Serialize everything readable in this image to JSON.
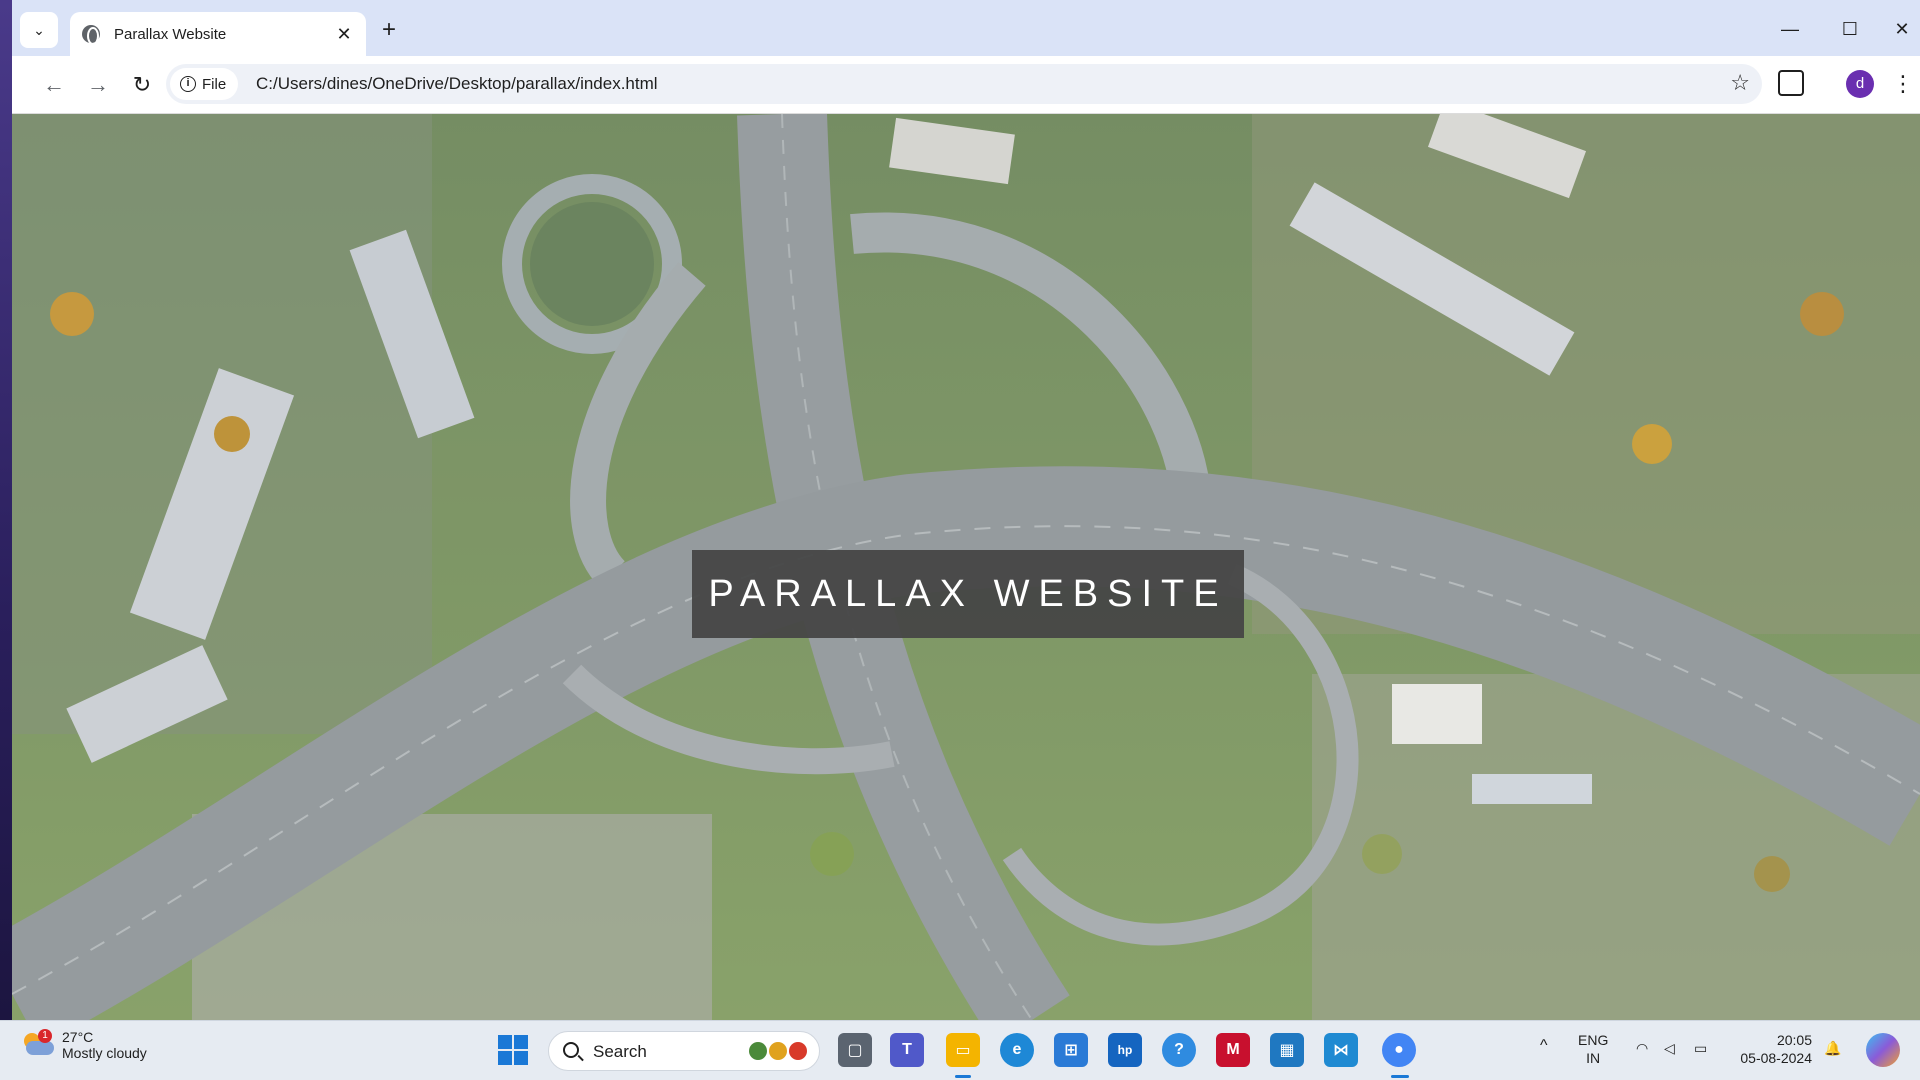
{
  "browser": {
    "tab_title": "Parallax Website",
    "tab_close": "✕",
    "new_tab": "+",
    "chip_label": "File",
    "url": "C:/Users/dines/OneDrive/Desktop/parallax/index.html",
    "profile_initial": "d",
    "window_controls": {
      "minimize": "—",
      "maximize": "☐",
      "close": "✕"
    },
    "nav": {
      "back": "←",
      "forward": "→",
      "reload": "↻"
    },
    "icons": [
      "tab-search-icon",
      "globe-icon",
      "info-icon",
      "star-icon",
      "extensions-icon",
      "kebab-menu-icon"
    ]
  },
  "page": {
    "hero_title": "PARALLAX WEBSITE"
  },
  "taskbar": {
    "weather": {
      "temp": "27°C",
      "desc": "Mostly cloudy",
      "badge": "1"
    },
    "search_label": "Search",
    "lang": {
      "line1": "ENG",
      "line2": "IN"
    },
    "time": "20:05",
    "date": "05-08-2024",
    "chevron": "^",
    "tray_icons": [
      "wifi-icon",
      "volume-icon",
      "battery-icon",
      "bell-icon"
    ],
    "apps": [
      "file-explorer-icon",
      "teams-icon",
      "folder-icon",
      "edge-icon",
      "store-icon",
      "myhp-icon",
      "help-icon",
      "mcafee-icon",
      "calculator-icon",
      "vscode-icon",
      "chrome-icon"
    ]
  },
  "colors": {
    "tabstrip_bg": "#dae3f7",
    "hero_box_bg": "#464646",
    "accent": "#1a78d6",
    "profile": "#6a2fb0"
  }
}
